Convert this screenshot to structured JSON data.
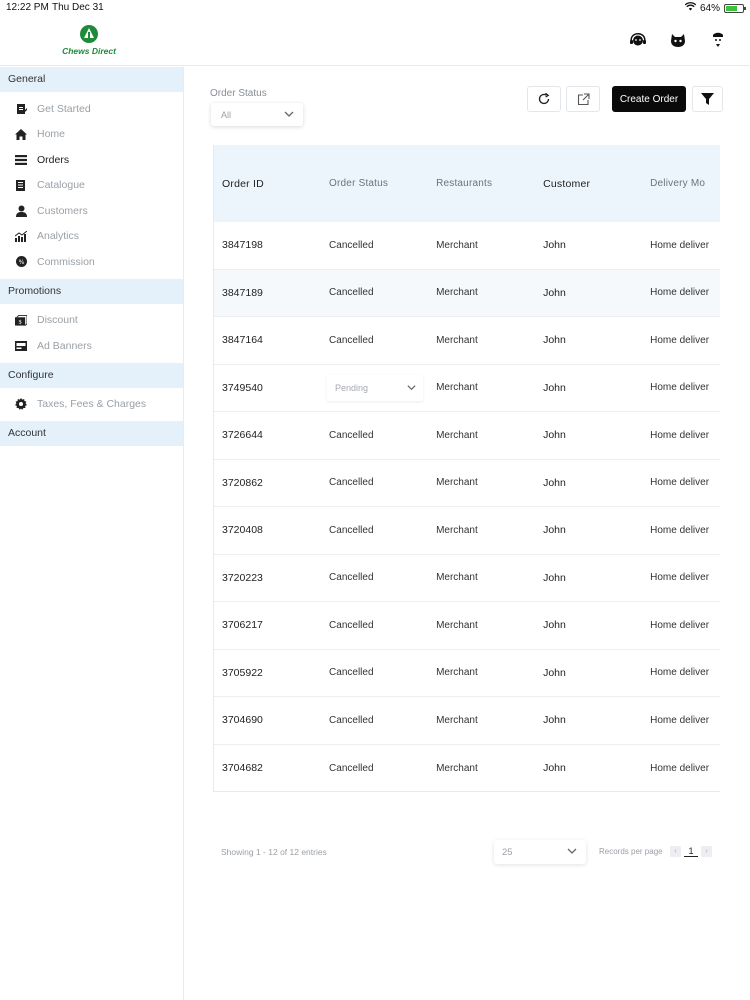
{
  "status_bar": {
    "time": "12:22 PM",
    "date": "Thu Dec 31",
    "battery": "64%"
  },
  "header": {
    "brand": "Chews Direct",
    "icons": [
      "support-icon",
      "chat-bot-icon",
      "profile-icon"
    ]
  },
  "sidebar": {
    "sections": [
      {
        "title": "General",
        "items": [
          {
            "label": "Get Started",
            "icon": "clipboard-icon",
            "active": false
          },
          {
            "label": "Home",
            "icon": "home-icon",
            "active": false
          },
          {
            "label": "Orders",
            "icon": "orders-icon",
            "active": true
          },
          {
            "label": "Catalogue",
            "icon": "catalogue-icon",
            "active": false
          },
          {
            "label": "Customers",
            "icon": "customer-icon",
            "active": false
          },
          {
            "label": "Analytics",
            "icon": "analytics-icon",
            "active": false
          },
          {
            "label": "Commission",
            "icon": "percent-icon",
            "active": false
          }
        ]
      },
      {
        "title": "Promotions",
        "items": [
          {
            "label": "Discount",
            "icon": "discount-icon",
            "active": false
          },
          {
            "label": "Ad Banners",
            "icon": "banner-icon",
            "active": false
          }
        ]
      },
      {
        "title": "Configure",
        "items": [
          {
            "label": "Taxes, Fees & Charges",
            "icon": "settings-icon",
            "active": false
          }
        ]
      },
      {
        "title": "Account",
        "items": []
      }
    ]
  },
  "toolbar": {
    "filter_label": "Order Status",
    "filter_value": "All",
    "create_label": "Create Order"
  },
  "table": {
    "columns": [
      "Order ID",
      "Order Status",
      "Restaurants",
      "Customer",
      "Delivery Mo"
    ],
    "rows": [
      {
        "id": "3847198",
        "status": "Cancelled",
        "restaurant": "Merchant",
        "customer": "John",
        "delivery": "Home deliver"
      },
      {
        "id": "3847189",
        "status": "Cancelled",
        "restaurant": "Merchant",
        "customer": "John",
        "delivery": "Home deliver"
      },
      {
        "id": "3847164",
        "status": "Cancelled",
        "restaurant": "Merchant",
        "customer": "John",
        "delivery": "Home deliver"
      },
      {
        "id": "3749540",
        "status": "Pending",
        "restaurant": "Merchant",
        "customer": "John",
        "delivery": "Home deliver"
      },
      {
        "id": "3726644",
        "status": "Cancelled",
        "restaurant": "Merchant",
        "customer": "John",
        "delivery": "Home deliver"
      },
      {
        "id": "3720862",
        "status": "Cancelled",
        "restaurant": "Merchant",
        "customer": "John",
        "delivery": "Home deliver"
      },
      {
        "id": "3720408",
        "status": "Cancelled",
        "restaurant": "Merchant",
        "customer": "John",
        "delivery": "Home deliver"
      },
      {
        "id": "3720223",
        "status": "Cancelled",
        "restaurant": "Merchant",
        "customer": "John",
        "delivery": "Home deliver"
      },
      {
        "id": "3706217",
        "status": "Cancelled",
        "restaurant": "Merchant",
        "customer": "John",
        "delivery": "Home deliver"
      },
      {
        "id": "3705922",
        "status": "Cancelled",
        "restaurant": "Merchant",
        "customer": "John",
        "delivery": "Home deliver"
      },
      {
        "id": "3704690",
        "status": "Cancelled",
        "restaurant": "Merchant",
        "customer": "John",
        "delivery": "Home deliver"
      },
      {
        "id": "3704682",
        "status": "Cancelled",
        "restaurant": "Merchant",
        "customer": "John",
        "delivery": "Home deliver"
      }
    ]
  },
  "footer": {
    "showing": "Showing 1 - 12 of 12 entries",
    "per_page_value": "25",
    "per_page_label": "Records per page",
    "page": "1"
  },
  "colors": {
    "brand_green": "#1e8a3a",
    "section_bg": "#e4f1fb",
    "header_bg": "#ecf5fb"
  }
}
